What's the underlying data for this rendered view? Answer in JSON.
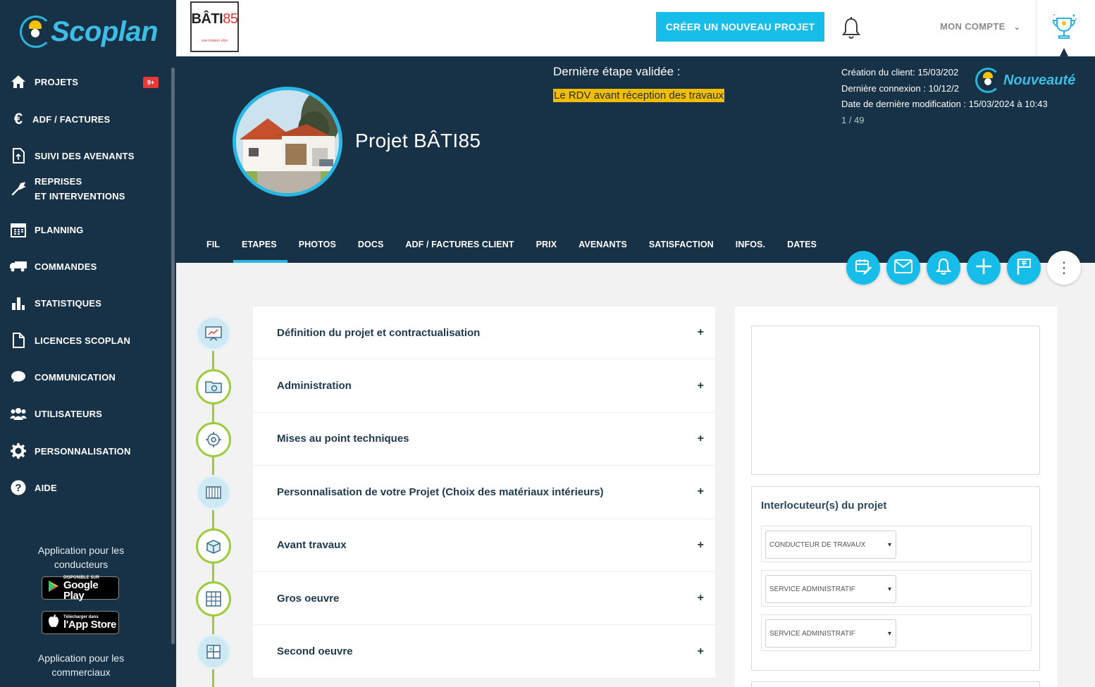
{
  "brand": {
    "name": "Scoplan",
    "colors": {
      "accent": "#17bde9",
      "navy": "#173246",
      "green": "#9ccb3b",
      "highlight": "#f5bc00"
    }
  },
  "company_logo": {
    "main": "BÂTI",
    "suffix": "85",
    "tagline": "une maison sûre"
  },
  "sidebar": {
    "items": [
      {
        "label": "PROJETS",
        "icon": "home-icon",
        "badge": "9+"
      },
      {
        "label": "ADF / FACTURES",
        "icon": "euro-icon"
      },
      {
        "label": "SUIVI DES AVENANTS",
        "icon": "document-icon"
      },
      {
        "label": "REPRISES\nET INTERVENTIONS",
        "icon": "wrench-icon"
      },
      {
        "label": "PLANNING",
        "icon": "calendar-icon"
      },
      {
        "label": "COMMANDES",
        "icon": "truck-icon"
      },
      {
        "label": "STATISTIQUES",
        "icon": "bar-chart-icon"
      },
      {
        "label": "LICENCES SCOPLAN",
        "icon": "file-icon"
      },
      {
        "label": "COMMUNICATION",
        "icon": "chat-icon"
      },
      {
        "label": "UTILISATEURS",
        "icon": "users-icon"
      },
      {
        "label": "PERSONNALISATION",
        "icon": "gear-icon"
      },
      {
        "label": "AIDE",
        "icon": "help-icon"
      }
    ],
    "app_conducteurs": "Application pour les\nconducteurs",
    "google_play": {
      "small": "DISPONIBLE SUR",
      "big": "Google Play"
    },
    "app_store": {
      "small": "Télécharger dans",
      "big": "l'App Store"
    },
    "app_commerciaux": "Application pour les\ncommerciaux"
  },
  "topbar": {
    "create_label": "CRÉER UN NOUVEAU PROJET",
    "account_label": "MON COMPTE"
  },
  "project": {
    "title": "Projet BÂTI85",
    "last_step_label": "Dernière étape validée :",
    "last_step_value": "Le RDV avant réception des travaux",
    "creation": "Création du client: 15/03/202",
    "last_login": "Dernière connexion : 10/12/2",
    "last_modif": "Date de dernière modification : 15/03/2024 à 10:43",
    "pager": "1 / 49",
    "nouveaute": "Nouveauté"
  },
  "tabs": [
    "FIL",
    "ETAPES",
    "PHOTOS",
    "DOCS",
    "ADF / FACTURES CLIENT",
    "PRIX",
    "AVENANTS",
    "SATISFACTION",
    "INFOS.",
    "DATES"
  ],
  "active_tab": "ETAPES",
  "actions": [
    "calendar-edit-icon",
    "mail-icon",
    "bell-icon",
    "plus-icon",
    "flag-icon",
    "more-vertical-icon"
  ],
  "steps": [
    {
      "title": "Définition du projet et contractualisation",
      "node": "blue",
      "icon": "presentation-icon"
    },
    {
      "title": "Administration",
      "node": "green",
      "icon": "folder-settings-icon"
    },
    {
      "title": "Mises au point techniques",
      "node": "green",
      "icon": "technical-gear-icon"
    },
    {
      "title": "Personnalisation de votre Projet (Choix des matériaux intérieurs)",
      "node": "blue",
      "icon": "materials-icon"
    },
    {
      "title": "Avant travaux",
      "node": "green",
      "icon": "box-icon"
    },
    {
      "title": "Gros oeuvre",
      "node": "green",
      "icon": "structure-icon"
    },
    {
      "title": "Second oeuvre",
      "node": "blue",
      "icon": "interior-icon"
    }
  ],
  "interlocuteurs": {
    "title": "Interlocuteur(s) du projet",
    "rows": [
      "CONDUCTEUR DE TRAVAUX",
      "SERVICE ADMINISTRATIF",
      "SERVICE ADMINISTRATIF"
    ]
  }
}
